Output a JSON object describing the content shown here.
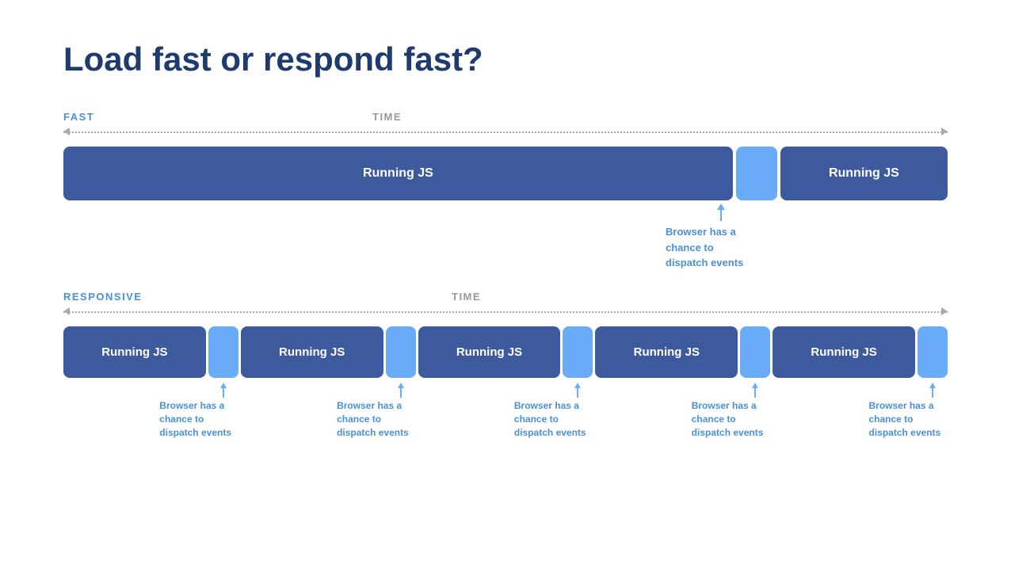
{
  "title": "Load fast or respond fast?",
  "fast_section": {
    "label_fast": "FAST",
    "label_time": "TIME",
    "label_time_position": "390px",
    "block1_label": "Running JS",
    "block2_label": "Running JS",
    "annotation_text": "Browser has a\nchance to\ndispatch events"
  },
  "responsive_section": {
    "label_responsive": "RESPONSIVE",
    "label_time": "TIME",
    "label_time_position": "490px",
    "block_labels": [
      "Running JS",
      "Running JS",
      "Running JS",
      "Running JS",
      "Running JS"
    ],
    "annotation_texts": [
      "Browser has a\nchance to\ndispatch events",
      "Browser has a\nchance to\ndispatch events",
      "Browser has a\nchance to\ndispatch events",
      "Browser has a\nchance to\ndispatch events",
      "Browser has a\nchance to\ndispatch events"
    ]
  },
  "colors": {
    "title": "#1e3a6e",
    "block_bg": "#3d5a9e",
    "gap_bg": "#6aabf7",
    "annotation": "#4a90d9",
    "label_fast": "#4a90d9",
    "label_responsive": "#4a90d9",
    "label_time": "#999999",
    "arrow": "#aaaaaa"
  }
}
